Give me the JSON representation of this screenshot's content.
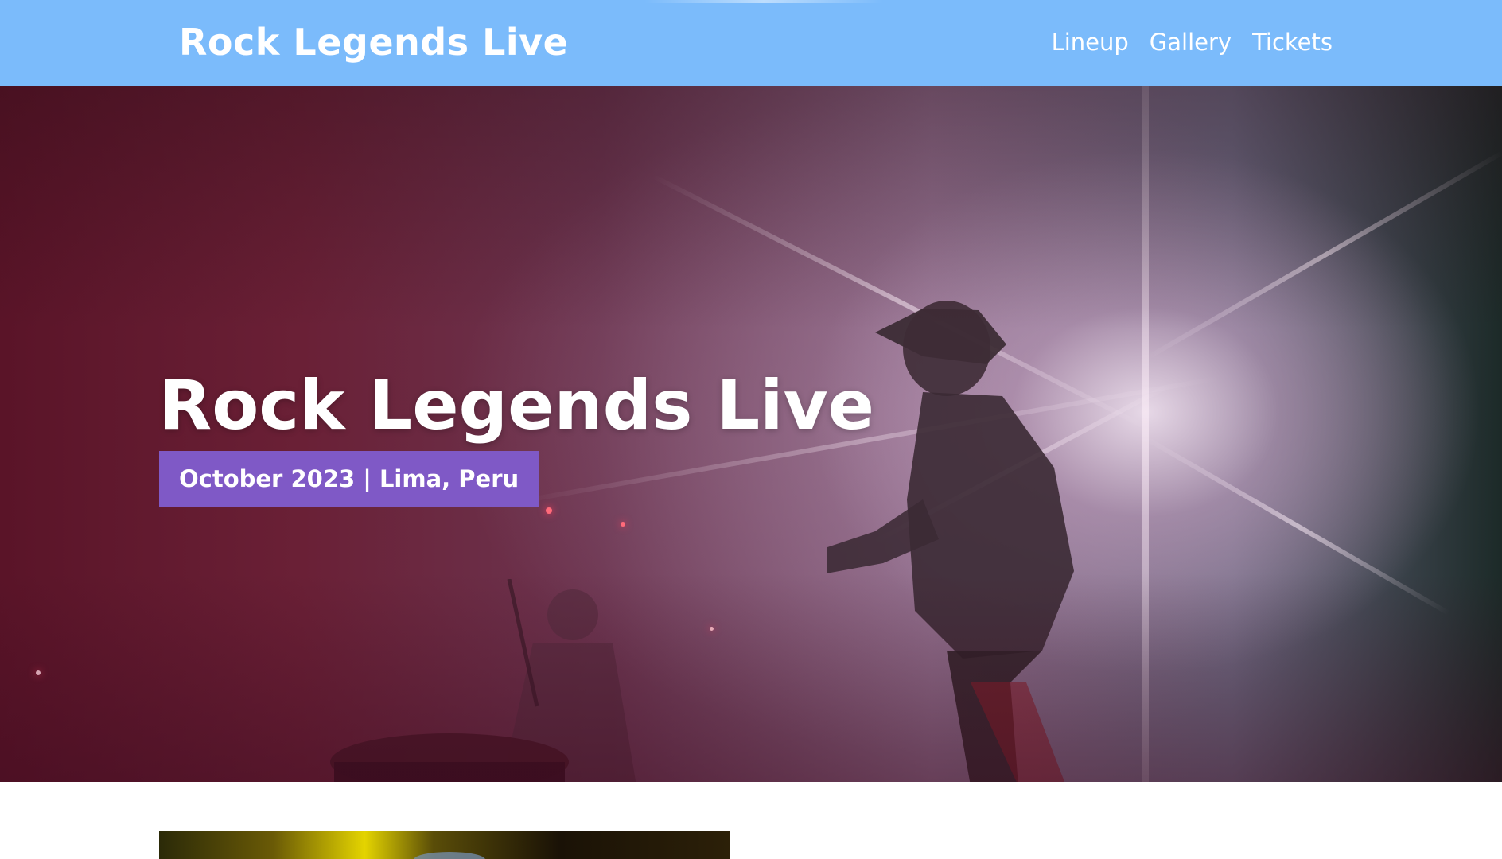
{
  "header": {
    "brand": "Rock Legends Live",
    "nav": [
      {
        "label": "Lineup"
      },
      {
        "label": "Gallery"
      },
      {
        "label": "Tickets"
      }
    ],
    "background_color": "#7bbbfb"
  },
  "hero": {
    "title": "Rock Legends Live",
    "badge": "October 2023 | Lima, Peru",
    "badge_color": "#7f59c6",
    "image_subject": "concert-stage-photo"
  },
  "next_section": {
    "image_subject": "stage-lights-photo"
  }
}
